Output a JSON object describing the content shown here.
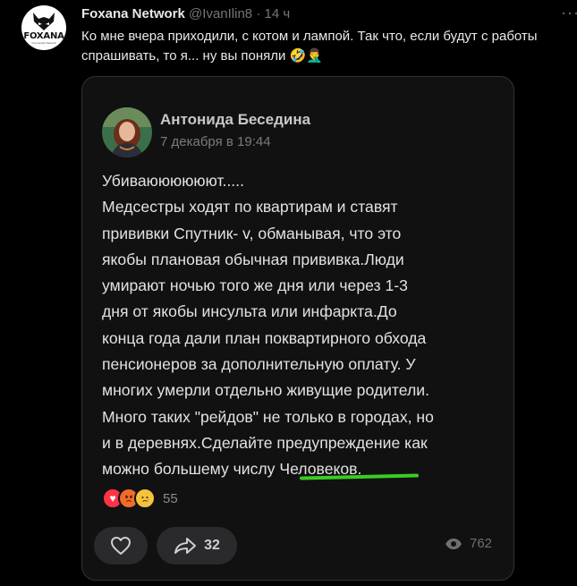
{
  "tweet": {
    "display_name": "Foxana Network",
    "handle": "@IvanIlin8",
    "separator": "·",
    "time": "14 ч",
    "more_icon": "more-horizontal-icon",
    "avatar": {
      "brand": "FOXANA",
      "tagline": "Community Network"
    },
    "text": "Ко мне вчера приходили, с котом и лампой. Так что, если будут с работы спрашивать, то я... ну вы поняли",
    "emojis": "🤣🤦‍♂️"
  },
  "quoted_post": {
    "author": "Антонида Беседина",
    "date": "7 декабря в 19:44",
    "lines": [
      "Убиваюююююют.....",
      "Медсестры ходят по квартирам и ставят",
      "прививки Спутник- v, обманывая, что это",
      "якобы плановая обычная прививка.Люди",
      "умирают ночью того же дня или через 1-3",
      "дня от якобы инсульта или инфаркта.До",
      "конца года дали план поквартирного обхода",
      "пенсионеров за дополнительную оплату. У",
      "многих умерли отдельно живущие родители.",
      "Много таких \"рейдов\" не только в городах, но",
      "и в деревнях.Сделайте предупреждение как",
      "можно большему числу Человеков."
    ],
    "reactions": {
      "icons": [
        "heart-icon",
        "angry-face-icon",
        "sad-face-icon"
      ],
      "count": "55"
    },
    "like_icon": "heart-outline-icon",
    "share_icon": "share-arrow-icon",
    "share_count": "32",
    "views_icon": "eye-icon",
    "views": "762"
  },
  "colors": {
    "background": "#000000",
    "card_background": "#111112",
    "underline": "#3bcc22",
    "muted": "#71767b"
  }
}
